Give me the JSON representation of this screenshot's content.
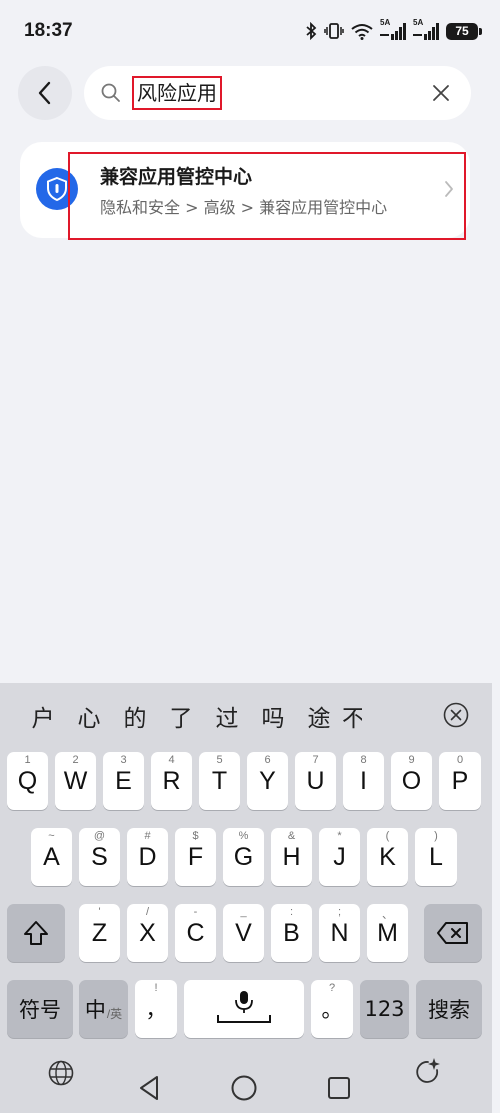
{
  "status_bar": {
    "time": "18:37",
    "icons": [
      "bluetooth-icon",
      "vibrate-icon",
      "wifi-icon",
      "signal-icon",
      "signal-icon"
    ],
    "signal_1_tag": "5A",
    "signal_2_tag": "5A",
    "battery_level": "75"
  },
  "search": {
    "query": "风险应用",
    "back_icon": "chevron-left-icon",
    "search_icon": "search-icon",
    "clear_icon": "close-icon"
  },
  "result": {
    "title": "兼容应用管控中心",
    "path": "隐私和安全 > 高级 > 兼容应用管控中心",
    "icon": "shield-icon",
    "icon_color": "#2368e8"
  },
  "keyboard": {
    "candidates": [
      "户",
      "心",
      "的",
      "了",
      "过",
      "吗",
      "途",
      "不"
    ],
    "row1": [
      {
        "letter": "Q",
        "hint": "1"
      },
      {
        "letter": "W",
        "hint": "2"
      },
      {
        "letter": "E",
        "hint": "3"
      },
      {
        "letter": "R",
        "hint": "4"
      },
      {
        "letter": "T",
        "hint": "5"
      },
      {
        "letter": "Y",
        "hint": "6"
      },
      {
        "letter": "U",
        "hint": "7"
      },
      {
        "letter": "I",
        "hint": "8"
      },
      {
        "letter": "O",
        "hint": "9"
      },
      {
        "letter": "P",
        "hint": "0"
      }
    ],
    "row2": [
      {
        "letter": "A",
        "hint": "~"
      },
      {
        "letter": "S",
        "hint": "@"
      },
      {
        "letter": "D",
        "hint": "#"
      },
      {
        "letter": "F",
        "hint": "$"
      },
      {
        "letter": "G",
        "hint": "%"
      },
      {
        "letter": "H",
        "hint": "&"
      },
      {
        "letter": "J",
        "hint": "*"
      },
      {
        "letter": "K",
        "hint": "("
      },
      {
        "letter": "L",
        "hint": ")"
      }
    ],
    "row3": [
      {
        "letter": "Z",
        "hint": "'"
      },
      {
        "letter": "X",
        "hint": "/"
      },
      {
        "letter": "C",
        "hint": "-"
      },
      {
        "letter": "V",
        "hint": "_"
      },
      {
        "letter": "B",
        "hint": ":"
      },
      {
        "letter": "N",
        "hint": ";"
      },
      {
        "letter": "M",
        "hint": "、"
      }
    ],
    "symbols_label": "符号",
    "lang_label": "中",
    "lang_sub": "/英",
    "comma_label": "，",
    "comma_hint": "!",
    "period_label": "。",
    "period_hint": "?",
    "numbers_label": "123",
    "search_label": "搜索",
    "accent_color": "#e0182a"
  },
  "nav_bar": {
    "icons": [
      "globe-icon",
      "back-triangle-icon",
      "home-circle-icon",
      "recents-square-icon",
      "sparkle-rotate-icon"
    ]
  }
}
